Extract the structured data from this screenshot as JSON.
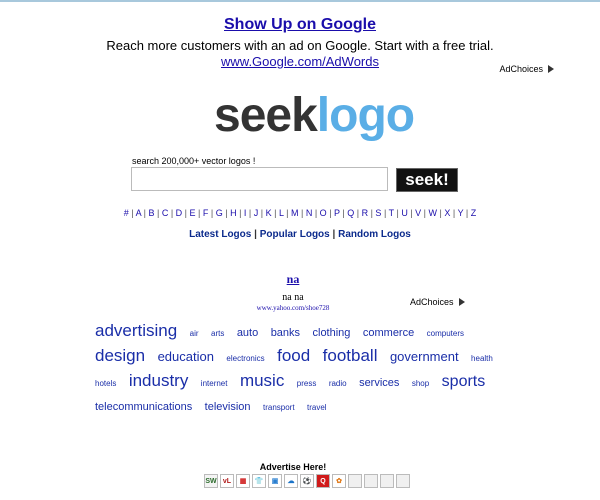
{
  "top_ad": {
    "title": "Show Up on Google",
    "description": "Reach more customers with an ad on Google. Start with a free trial.",
    "url": "www.Google.com/AdWords",
    "adchoices": "AdChoices"
  },
  "logo": {
    "part1": "seek",
    "part2": "logo"
  },
  "search": {
    "label": "search 200,000+ vector logos !",
    "value": "",
    "button": "seek!"
  },
  "alphabet": [
    "#",
    "A",
    "B",
    "C",
    "D",
    "E",
    "F",
    "G",
    "H",
    "I",
    "J",
    "K",
    "L",
    "M",
    "N",
    "O",
    "P",
    "Q",
    "R",
    "S",
    "T",
    "U",
    "V",
    "W",
    "X",
    "Y",
    "Z"
  ],
  "nav": {
    "latest": "Latest Logos",
    "popular": "Popular Logos",
    "random": "Random Logos",
    "separator": "|"
  },
  "second_ad": {
    "title": "na",
    "description": "na na",
    "url": "www.yahoo.com/shoe728",
    "adchoices": "AdChoices"
  },
  "tag_cloud": [
    {
      "label": "advertising",
      "size": 17
    },
    {
      "label": "air",
      "size": 8
    },
    {
      "label": "arts",
      "size": 8
    },
    {
      "label": "auto",
      "size": 11
    },
    {
      "label": "banks",
      "size": 11
    },
    {
      "label": "clothing",
      "size": 11
    },
    {
      "label": "commerce",
      "size": 11
    },
    {
      "label": "computers",
      "size": 8
    },
    {
      "label": "design",
      "size": 17
    },
    {
      "label": "education",
      "size": 13
    },
    {
      "label": "electronics",
      "size": 8
    },
    {
      "label": "food",
      "size": 17
    },
    {
      "label": "football",
      "size": 17
    },
    {
      "label": "government",
      "size": 13
    },
    {
      "label": "health",
      "size": 8
    },
    {
      "label": "hotels",
      "size": 8
    },
    {
      "label": "industry",
      "size": 17
    },
    {
      "label": "internet",
      "size": 8
    },
    {
      "label": "music",
      "size": 17
    },
    {
      "label": "press",
      "size": 8
    },
    {
      "label": "radio",
      "size": 8
    },
    {
      "label": "services",
      "size": 11
    },
    {
      "label": "shop",
      "size": 8
    },
    {
      "label": "sports",
      "size": 16
    },
    {
      "label": "telecommunications",
      "size": 11
    },
    {
      "label": "television",
      "size": 11
    },
    {
      "label": "transport",
      "size": 8
    },
    {
      "label": "travel",
      "size": 8
    }
  ],
  "advertise": {
    "label": "Advertise Here!"
  },
  "sponsor_icons": [
    {
      "name": "sw-icon",
      "text": "SW",
      "bg": "#f4f4f4",
      "color": "#2a6a2a"
    },
    {
      "name": "vl-icon",
      "text": "vL",
      "bg": "#fff",
      "color": "#b01a1a"
    },
    {
      "name": "grid-icon",
      "text": "▦",
      "bg": "#fff",
      "color": "#d02020"
    },
    {
      "name": "shirt-icon",
      "text": "👕",
      "bg": "#fff",
      "color": "#333"
    },
    {
      "name": "box-icon",
      "text": "▣",
      "bg": "#fff",
      "color": "#2a7fd0"
    },
    {
      "name": "cloud-icon",
      "text": "☁",
      "bg": "#fff",
      "color": "#1a73c8"
    },
    {
      "name": "ball-icon",
      "text": "⚽",
      "bg": "#fff",
      "color": "#000"
    },
    {
      "name": "q-icon",
      "text": "Q",
      "bg": "#d01a1a",
      "color": "#fff"
    },
    {
      "name": "cake-icon",
      "text": "✿",
      "bg": "#fff",
      "color": "#e07a1a"
    },
    {
      "name": "empty-slot-icon",
      "text": "",
      "bg": "#f0f0f0",
      "color": "#000"
    },
    {
      "name": "empty-slot-icon",
      "text": "",
      "bg": "#f0f0f0",
      "color": "#000"
    },
    {
      "name": "empty-slot-icon",
      "text": "",
      "bg": "#f0f0f0",
      "color": "#000"
    },
    {
      "name": "empty-slot-icon",
      "text": "",
      "bg": "#f0f0f0",
      "color": "#000"
    }
  ]
}
